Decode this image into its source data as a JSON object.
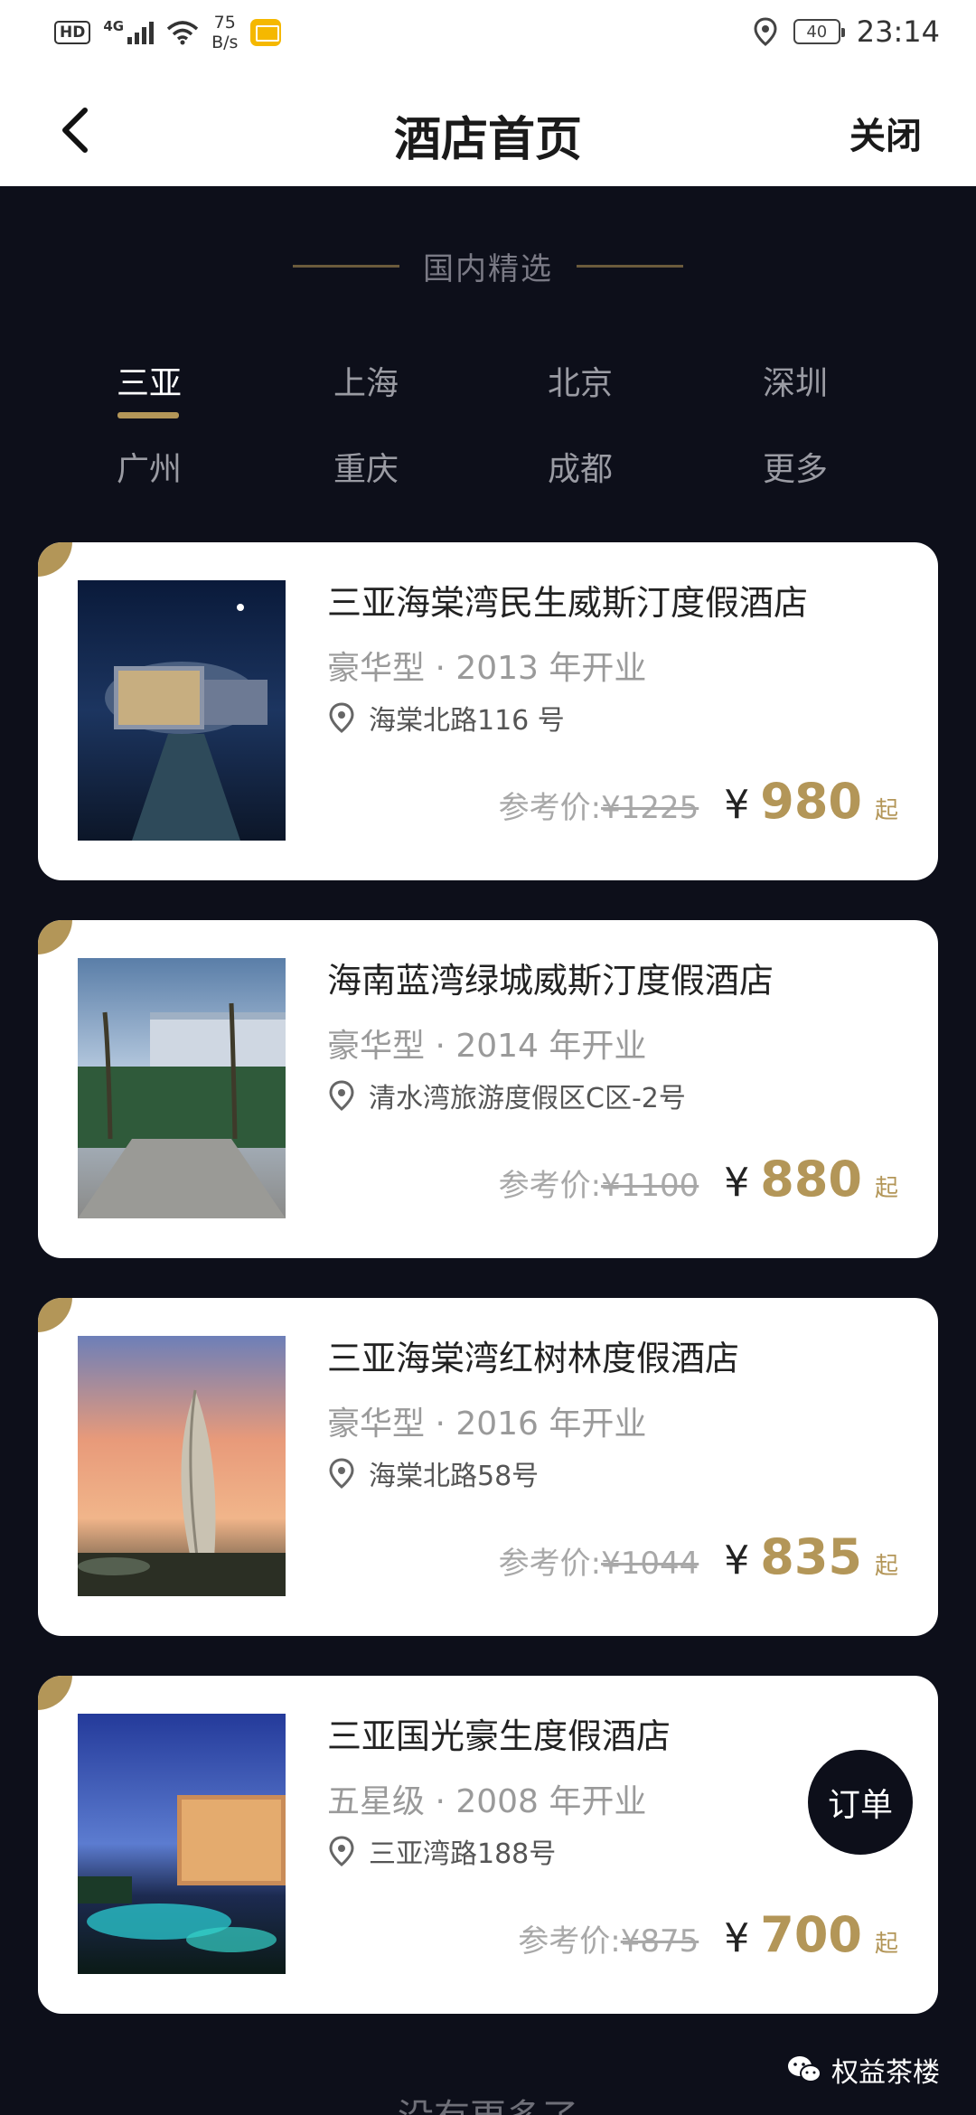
{
  "status_bar": {
    "hd": "HD",
    "network": "4G",
    "speed_value": "75",
    "speed_unit": "B/s",
    "battery": "40",
    "time": "23:14"
  },
  "nav": {
    "title": "酒店首页",
    "close_label": "关闭"
  },
  "section": {
    "title": "国内精选"
  },
  "cities": [
    "三亚",
    "上海",
    "北京",
    "深圳",
    "广州",
    "重庆",
    "成都",
    "更多"
  ],
  "active_city": "三亚",
  "hotels": [
    {
      "name": "三亚海棠湾民生威斯汀度假酒店",
      "meta": "豪华型 · 2013 年开业",
      "address": "海棠北路116 号",
      "ref_label": "参考价:",
      "ref_price": "¥1225",
      "currency": "¥",
      "price": "980",
      "suffix": "起"
    },
    {
      "name": "海南蓝湾绿城威斯汀度假酒店",
      "meta": "豪华型 · 2014 年开业",
      "address": "清水湾旅游度假区C区-2号",
      "ref_label": "参考价:",
      "ref_price": "¥1100",
      "currency": "¥",
      "price": "880",
      "suffix": "起"
    },
    {
      "name": "三亚海棠湾红树林度假酒店",
      "meta": "豪华型 · 2016 年开业",
      "address": "海棠北路58号",
      "ref_label": "参考价:",
      "ref_price": "¥1044",
      "currency": "¥",
      "price": "835",
      "suffix": "起"
    },
    {
      "name": "三亚国光豪生度假酒店",
      "meta": "五星级 · 2008 年开业",
      "address": "三亚湾路188号",
      "ref_label": "参考价:",
      "ref_price": "¥875",
      "currency": "¥",
      "price": "700",
      "suffix": "起"
    }
  ],
  "order_button": "订单",
  "watermark": "权益茶楼",
  "footer": "没有更多了",
  "colors": {
    "background": "#0d0f1a",
    "accent_gold": "#b39658",
    "card": "#ffffff"
  },
  "icons": [
    "back-arrow-icon",
    "location-pin-icon",
    "wechat-icon"
  ]
}
